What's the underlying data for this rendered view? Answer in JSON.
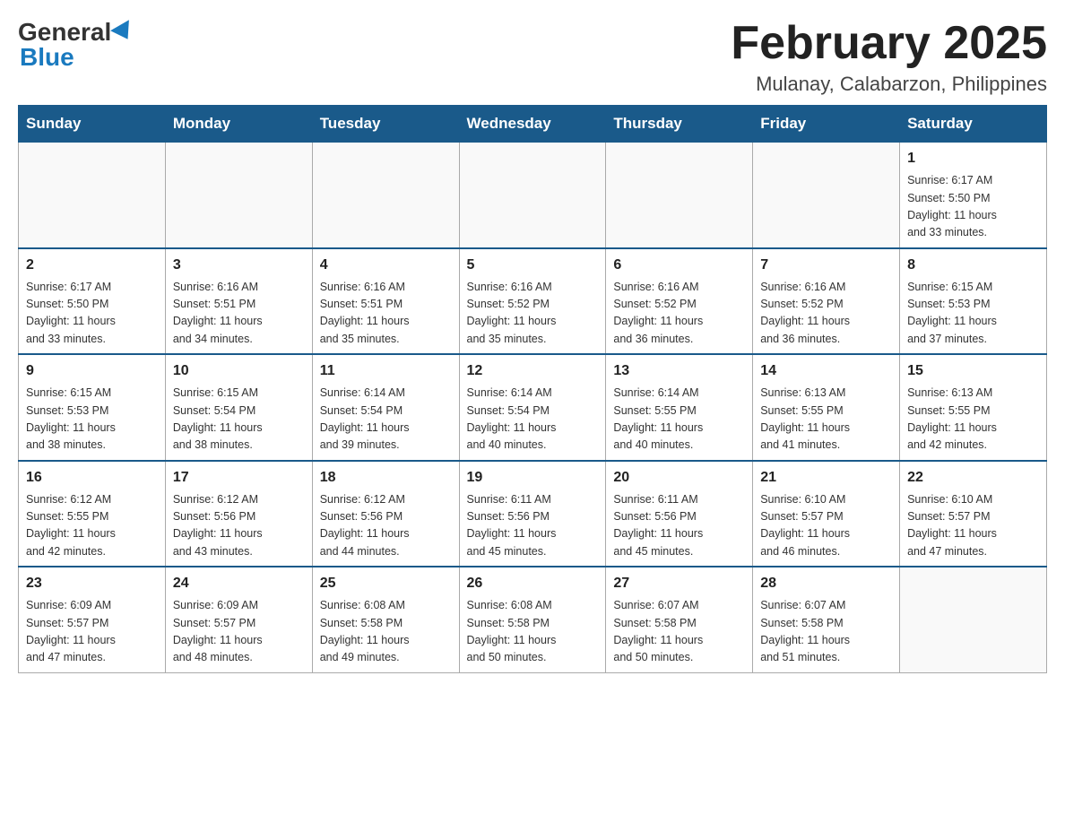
{
  "header": {
    "logo_general": "General",
    "logo_blue": "Blue",
    "title": "February 2025",
    "subtitle": "Mulanay, Calabarzon, Philippines"
  },
  "days_of_week": [
    "Sunday",
    "Monday",
    "Tuesday",
    "Wednesday",
    "Thursday",
    "Friday",
    "Saturday"
  ],
  "weeks": [
    [
      {
        "day": "",
        "info": ""
      },
      {
        "day": "",
        "info": ""
      },
      {
        "day": "",
        "info": ""
      },
      {
        "day": "",
        "info": ""
      },
      {
        "day": "",
        "info": ""
      },
      {
        "day": "",
        "info": ""
      },
      {
        "day": "1",
        "info": "Sunrise: 6:17 AM\nSunset: 5:50 PM\nDaylight: 11 hours\nand 33 minutes."
      }
    ],
    [
      {
        "day": "2",
        "info": "Sunrise: 6:17 AM\nSunset: 5:50 PM\nDaylight: 11 hours\nand 33 minutes."
      },
      {
        "day": "3",
        "info": "Sunrise: 6:16 AM\nSunset: 5:51 PM\nDaylight: 11 hours\nand 34 minutes."
      },
      {
        "day": "4",
        "info": "Sunrise: 6:16 AM\nSunset: 5:51 PM\nDaylight: 11 hours\nand 35 minutes."
      },
      {
        "day": "5",
        "info": "Sunrise: 6:16 AM\nSunset: 5:52 PM\nDaylight: 11 hours\nand 35 minutes."
      },
      {
        "day": "6",
        "info": "Sunrise: 6:16 AM\nSunset: 5:52 PM\nDaylight: 11 hours\nand 36 minutes."
      },
      {
        "day": "7",
        "info": "Sunrise: 6:16 AM\nSunset: 5:52 PM\nDaylight: 11 hours\nand 36 minutes."
      },
      {
        "day": "8",
        "info": "Sunrise: 6:15 AM\nSunset: 5:53 PM\nDaylight: 11 hours\nand 37 minutes."
      }
    ],
    [
      {
        "day": "9",
        "info": "Sunrise: 6:15 AM\nSunset: 5:53 PM\nDaylight: 11 hours\nand 38 minutes."
      },
      {
        "day": "10",
        "info": "Sunrise: 6:15 AM\nSunset: 5:54 PM\nDaylight: 11 hours\nand 38 minutes."
      },
      {
        "day": "11",
        "info": "Sunrise: 6:14 AM\nSunset: 5:54 PM\nDaylight: 11 hours\nand 39 minutes."
      },
      {
        "day": "12",
        "info": "Sunrise: 6:14 AM\nSunset: 5:54 PM\nDaylight: 11 hours\nand 40 minutes."
      },
      {
        "day": "13",
        "info": "Sunrise: 6:14 AM\nSunset: 5:55 PM\nDaylight: 11 hours\nand 40 minutes."
      },
      {
        "day": "14",
        "info": "Sunrise: 6:13 AM\nSunset: 5:55 PM\nDaylight: 11 hours\nand 41 minutes."
      },
      {
        "day": "15",
        "info": "Sunrise: 6:13 AM\nSunset: 5:55 PM\nDaylight: 11 hours\nand 42 minutes."
      }
    ],
    [
      {
        "day": "16",
        "info": "Sunrise: 6:12 AM\nSunset: 5:55 PM\nDaylight: 11 hours\nand 42 minutes."
      },
      {
        "day": "17",
        "info": "Sunrise: 6:12 AM\nSunset: 5:56 PM\nDaylight: 11 hours\nand 43 minutes."
      },
      {
        "day": "18",
        "info": "Sunrise: 6:12 AM\nSunset: 5:56 PM\nDaylight: 11 hours\nand 44 minutes."
      },
      {
        "day": "19",
        "info": "Sunrise: 6:11 AM\nSunset: 5:56 PM\nDaylight: 11 hours\nand 45 minutes."
      },
      {
        "day": "20",
        "info": "Sunrise: 6:11 AM\nSunset: 5:56 PM\nDaylight: 11 hours\nand 45 minutes."
      },
      {
        "day": "21",
        "info": "Sunrise: 6:10 AM\nSunset: 5:57 PM\nDaylight: 11 hours\nand 46 minutes."
      },
      {
        "day": "22",
        "info": "Sunrise: 6:10 AM\nSunset: 5:57 PM\nDaylight: 11 hours\nand 47 minutes."
      }
    ],
    [
      {
        "day": "23",
        "info": "Sunrise: 6:09 AM\nSunset: 5:57 PM\nDaylight: 11 hours\nand 47 minutes."
      },
      {
        "day": "24",
        "info": "Sunrise: 6:09 AM\nSunset: 5:57 PM\nDaylight: 11 hours\nand 48 minutes."
      },
      {
        "day": "25",
        "info": "Sunrise: 6:08 AM\nSunset: 5:58 PM\nDaylight: 11 hours\nand 49 minutes."
      },
      {
        "day": "26",
        "info": "Sunrise: 6:08 AM\nSunset: 5:58 PM\nDaylight: 11 hours\nand 50 minutes."
      },
      {
        "day": "27",
        "info": "Sunrise: 6:07 AM\nSunset: 5:58 PM\nDaylight: 11 hours\nand 50 minutes."
      },
      {
        "day": "28",
        "info": "Sunrise: 6:07 AM\nSunset: 5:58 PM\nDaylight: 11 hours\nand 51 minutes."
      },
      {
        "day": "",
        "info": ""
      }
    ]
  ]
}
